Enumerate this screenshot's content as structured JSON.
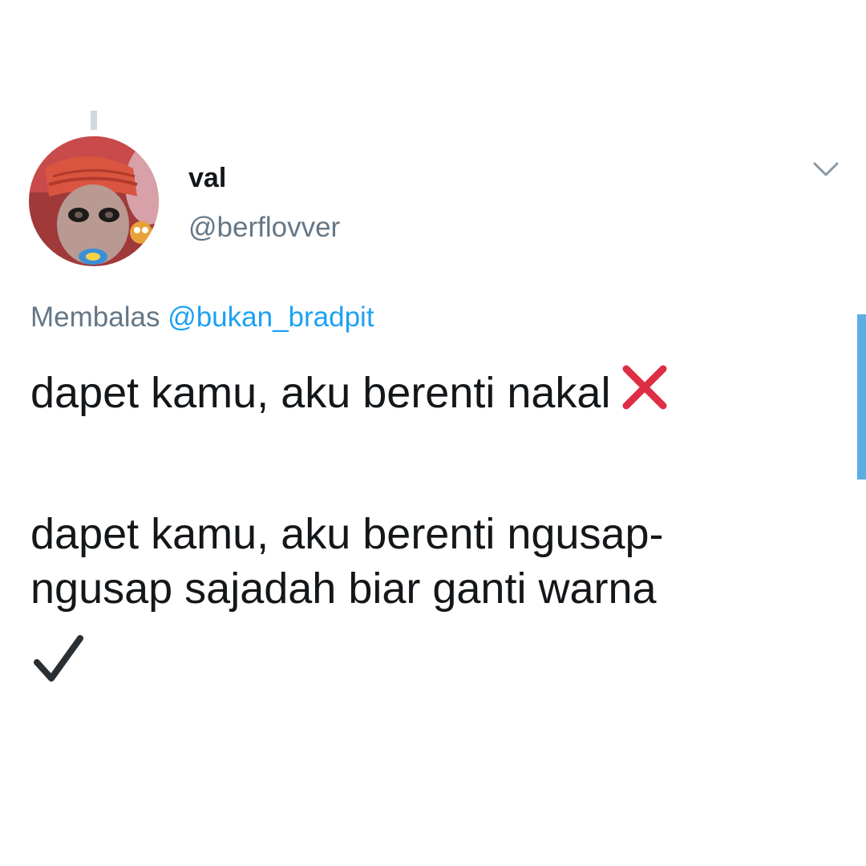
{
  "tweet": {
    "author": {
      "display_name": "val",
      "handle": "@berflovver",
      "avatar_icon": "profile-photo"
    },
    "reply": {
      "prefix": "Membalas",
      "mention": "@bukan_bradpit"
    },
    "body": {
      "line1": "dapet kamu, aku berenti nakal",
      "line1_icon": "cross-mark-icon",
      "line2a": "dapet kamu, aku berenti ngusap-",
      "line2b": "ngusap sajadah biar ganti warna",
      "line2_icon": "check-mark-icon"
    },
    "menu_icon": "chevron-down-icon"
  },
  "colors": {
    "text_primary": "#14171a",
    "text_secondary": "#657786",
    "link": "#1da1f2",
    "cross": "#dd2e44",
    "check": "#292f33",
    "scroll": "#5dade2"
  }
}
